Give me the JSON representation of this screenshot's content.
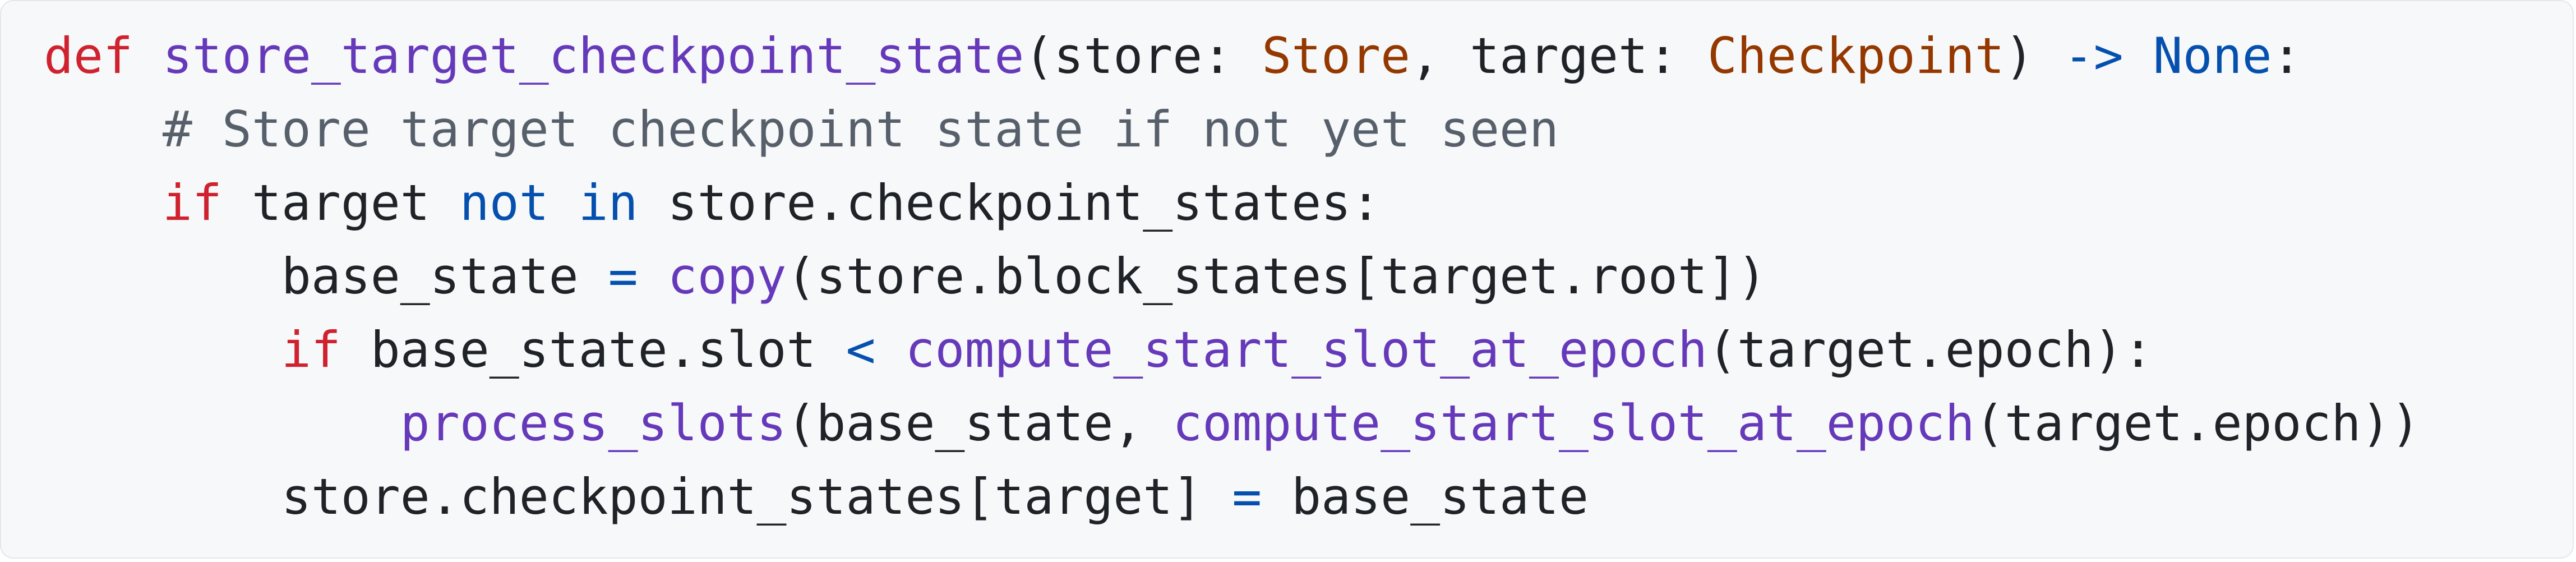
{
  "colors": {
    "background": "#f6f8fa",
    "border": "#e4e7eb",
    "keyword": "#cf222e",
    "function": "#6639ba",
    "operator": "#0550ae",
    "type": "#953800",
    "comment": "#57606a",
    "plain": "#1f2328"
  },
  "code": {
    "language": "python",
    "lines": [
      {
        "tokens": [
          {
            "text": "def",
            "kind": "kw"
          },
          {
            "text": " ",
            "kind": "pl"
          },
          {
            "text": "store_target_checkpoint_state",
            "kind": "fn"
          },
          {
            "text": "(store: ",
            "kind": "pl"
          },
          {
            "text": "Store",
            "kind": "ty"
          },
          {
            "text": ", target: ",
            "kind": "pl"
          },
          {
            "text": "Checkpoint",
            "kind": "ty"
          },
          {
            "text": ") ",
            "kind": "pl"
          },
          {
            "text": "->",
            "kind": "op"
          },
          {
            "text": " ",
            "kind": "pl"
          },
          {
            "text": "None",
            "kind": "op"
          },
          {
            "text": ":",
            "kind": "pl"
          }
        ]
      },
      {
        "tokens": [
          {
            "text": "    ",
            "kind": "pl"
          },
          {
            "text": "# Store target checkpoint state if not yet seen",
            "kind": "cm"
          }
        ]
      },
      {
        "tokens": [
          {
            "text": "    ",
            "kind": "pl"
          },
          {
            "text": "if",
            "kind": "kw"
          },
          {
            "text": " target ",
            "kind": "pl"
          },
          {
            "text": "not",
            "kind": "op"
          },
          {
            "text": " ",
            "kind": "pl"
          },
          {
            "text": "in",
            "kind": "op"
          },
          {
            "text": " store.checkpoint_states:",
            "kind": "pl"
          }
        ]
      },
      {
        "tokens": [
          {
            "text": "        base_state ",
            "kind": "pl"
          },
          {
            "text": "=",
            "kind": "op"
          },
          {
            "text": " ",
            "kind": "pl"
          },
          {
            "text": "copy",
            "kind": "fn"
          },
          {
            "text": "(store.block_states[target.root])",
            "kind": "pl"
          }
        ]
      },
      {
        "tokens": [
          {
            "text": "        ",
            "kind": "pl"
          },
          {
            "text": "if",
            "kind": "kw"
          },
          {
            "text": " base_state.slot ",
            "kind": "pl"
          },
          {
            "text": "<",
            "kind": "op"
          },
          {
            "text": " ",
            "kind": "pl"
          },
          {
            "text": "compute_start_slot_at_epoch",
            "kind": "fn"
          },
          {
            "text": "(target.epoch):",
            "kind": "pl"
          }
        ]
      },
      {
        "tokens": [
          {
            "text": "            ",
            "kind": "pl"
          },
          {
            "text": "process_slots",
            "kind": "fn"
          },
          {
            "text": "(base_state, ",
            "kind": "pl"
          },
          {
            "text": "compute_start_slot_at_epoch",
            "kind": "fn"
          },
          {
            "text": "(target.epoch))",
            "kind": "pl"
          }
        ]
      },
      {
        "tokens": [
          {
            "text": "        store.checkpoint_states[target] ",
            "kind": "pl"
          },
          {
            "text": "=",
            "kind": "op"
          },
          {
            "text": " base_state",
            "kind": "pl"
          }
        ]
      }
    ]
  }
}
